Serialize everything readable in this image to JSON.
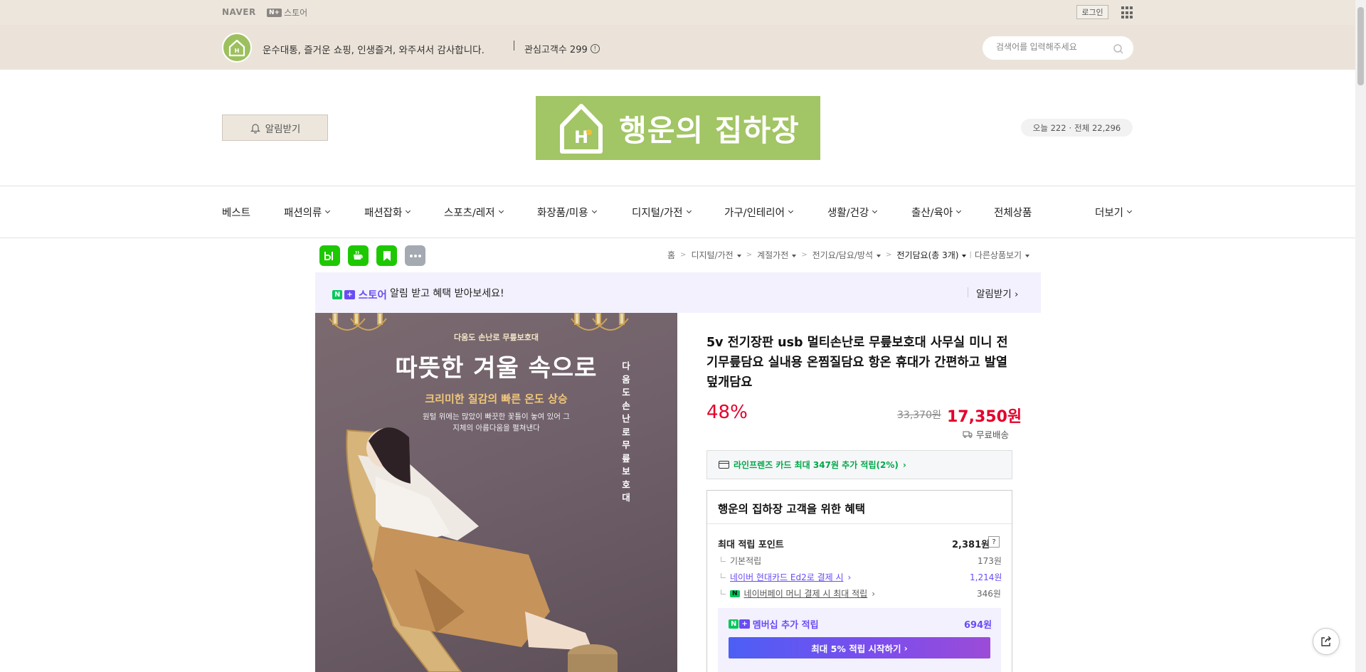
{
  "topbar": {
    "naver_logo": "NAVER",
    "np_mark": "N+",
    "store_label": "스토어",
    "login_label": "로그인"
  },
  "storebar": {
    "avatar_text": "행운의집하장",
    "slogan": "운수대통, 즐거운 쇼핑, 인생즐겨, 와주셔서 감사합니다.",
    "interest_label": "관심고객수 299",
    "search_placeholder": "검색어를 입력해주세요"
  },
  "header": {
    "notify_label": "알림받기",
    "brand_name": "행운의 집하장",
    "visitors_today": "오늘 222",
    "visitors_dot": "·",
    "visitors_total": "전체 22,296"
  },
  "nav": {
    "items": [
      {
        "label": "베스트"
      },
      {
        "label": "패션의류"
      },
      {
        "label": "패션잡화"
      },
      {
        "label": "스포츠/레저"
      },
      {
        "label": "화장품/미용"
      },
      {
        "label": "디지털/가전"
      },
      {
        "label": "가구/인테리어"
      },
      {
        "label": "생활/건강"
      },
      {
        "label": "출산/육아"
      },
      {
        "label": "전체상품"
      },
      {
        "label": "더보기"
      }
    ]
  },
  "breadcrumb": {
    "home": "홈",
    "cat1": "디지털/가전",
    "cat2": "계절가전",
    "cat3": "전기요/담요/방석",
    "current": "전기담요(총 3개)",
    "other": "다른상품보기"
  },
  "promo": {
    "badge_n": "N",
    "badge_plus": "+",
    "badge_text": "스토어",
    "text": "알림 받고 혜택 받아보세요!",
    "link_label": "알림받기"
  },
  "product_image": {
    "tagline_small": "다움도 손난로 무릎보호대",
    "headline": "따뜻한 겨울 속으로",
    "subhead": "크리미한 질감의 빠른 온도 상승",
    "body_line1": "원털 위에는 많았이 빠끗한 꽃틀이 놓여 있어 그",
    "body_line2": "지체의 아름다움을 펼쳐낸다",
    "vertical_text": "다움도손난로무릎보호대"
  },
  "product": {
    "title": "5v 전기장판 usb 멀티손난로 무릎보호대 사무실 미니 전기무릎담요 실내용 온찜질담요 항온 휴대가 간편하고 발열덮개담요",
    "discount_rate": "48%",
    "original_price": "33,370원",
    "sale_price": "17,350원",
    "shipping": "무료배송",
    "card_benefit": "라인프렌즈 카드 최대 347원 추가 적립(2%)"
  },
  "benefits": {
    "title": "행운의 집하장 고객을 위한 혜택",
    "max_points_label": "최대 적립 포인트",
    "max_points_value": "2,381원",
    "help": "?",
    "rows": [
      {
        "label": "기본적립",
        "value": "173원"
      },
      {
        "label": "네이버 현대카드 Ed2로 결제 시",
        "value": "1,214원"
      },
      {
        "label": "네이버페이 머니 결제 시 최대 적립",
        "value": "346원"
      }
    ],
    "npay_mark": "N",
    "membership_label": "멤버십 추가 적립",
    "membership_value": "694원",
    "membership_cta": "최대 5% 적립 시작하기"
  },
  "colors": {
    "accent_red": "#e4002b",
    "naver_green": "#03c75a",
    "plus_purple": "#6a4cf5",
    "brand_green": "#a2c565",
    "topbar_beige": "#ede6dd"
  },
  "icons": {
    "bell": "bell-icon",
    "search": "search-icon",
    "apps": "apps-grid-icon",
    "truck": "truck-icon",
    "card": "card-icon",
    "share": "share-icon"
  }
}
